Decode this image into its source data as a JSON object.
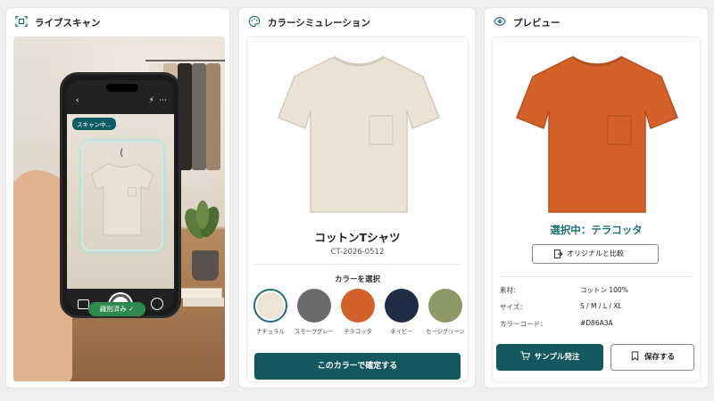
{
  "panels": {
    "live_scan": {
      "title": "ライブスキャン"
    },
    "color_sim": {
      "title": "カラーシミュレーション"
    },
    "preview": {
      "title": "プレビュー"
    }
  },
  "camera": {
    "scan_status": "スキャン中...",
    "identified": "識別済み ✓",
    "back_glyph": "‹",
    "flash_glyph": "⚡",
    "more_glyph": "⋯"
  },
  "product": {
    "name": "コットンTシャツ",
    "code": "CT-2026-0512"
  },
  "color_select": {
    "heading": "カラーを選択",
    "confirm_label": "このカラーで確定する",
    "options": [
      {
        "label": "ナチュラル",
        "hex": "#ede4d6"
      },
      {
        "label": "スモークグレー",
        "hex": "#6b6b6b"
      },
      {
        "label": "テラコッタ",
        "hex": "#d2622a"
      },
      {
        "label": "ネイビー",
        "hex": "#1e2c44"
      },
      {
        "label": "セージグリーン",
        "hex": "#8c9a67"
      }
    ]
  },
  "preview": {
    "selected_text": "選択中：テラコッタ",
    "compare_label": "オリジナルと比較",
    "specs": [
      {
        "key": "素材：",
        "value": "コットン 100%"
      },
      {
        "key": "サイズ：",
        "value": "S / M / L / XL"
      },
      {
        "key": "カラーコード：",
        "value": "#D86A3A"
      }
    ],
    "order_label": "サンプル発注",
    "save_label": "保存する"
  },
  "colors": {
    "accent": "#12585e",
    "natural_shirt": "#e9e0d2",
    "terracotta_shirt": "#d4612a",
    "identified_green": "#2e8a4f"
  }
}
